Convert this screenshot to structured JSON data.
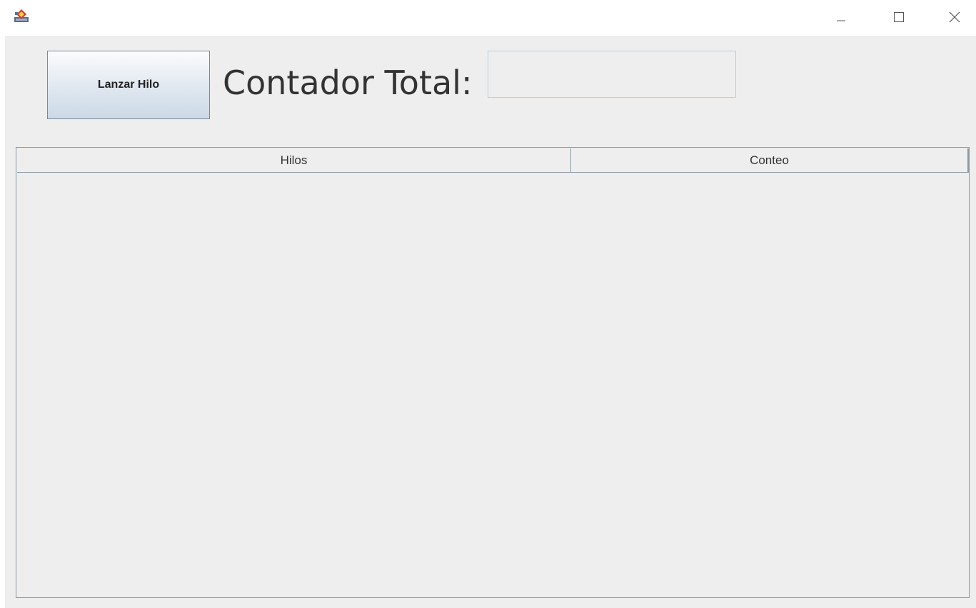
{
  "window": {
    "title": "",
    "controls": {
      "minimize_icon": "minimize-icon",
      "maximize_icon": "maximize-icon",
      "close_icon": "close-icon"
    }
  },
  "toolbar": {
    "launch_button_label": "Lanzar Hilo",
    "total_label": "Contador Total:",
    "total_value": ""
  },
  "table": {
    "columns": [
      "Hilos",
      "Conteo"
    ],
    "rows": []
  },
  "colors": {
    "content_background": "#eeeeee",
    "button_gradient_top": "#fbfcfd",
    "button_gradient_bottom": "#cbd9e6",
    "field_border": "#b8cfe5",
    "table_border": "#8c99a5"
  }
}
